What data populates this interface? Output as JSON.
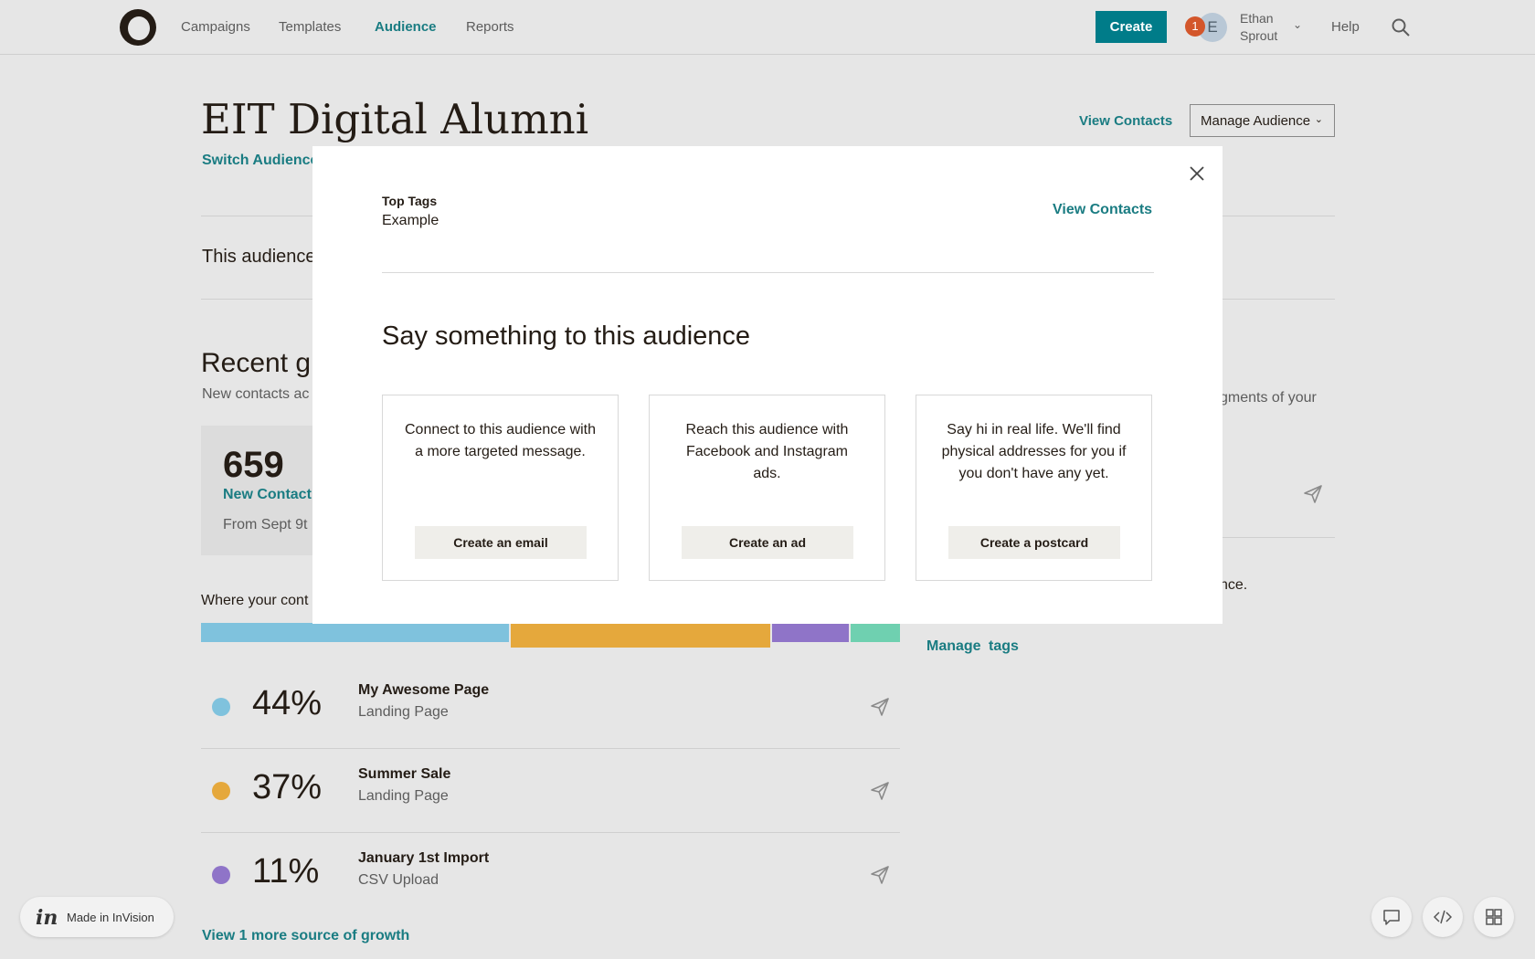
{
  "nav": {
    "links": [
      "Campaigns",
      "Templates",
      "Audience",
      "Reports"
    ],
    "create_label": "Create",
    "notifications": "1",
    "avatar_initial": "E",
    "user_first": "Ethan",
    "user_last": "Sprout",
    "help_label": "Help"
  },
  "page": {
    "title": "EIT Digital Alumni",
    "switch_label": "Switch Audience",
    "view_contacts": "View Contacts",
    "manage_audience": "Manage Audience",
    "audience_text": "This audience",
    "recent_title": "Recent gr",
    "recent_sub": "New contacts ac",
    "stat_number": "659",
    "stat_label": "New Contact",
    "stat_date": "From Sept 9t",
    "where_text": "Where your cont",
    "right_fragment_1": "gments of your",
    "right_fragment_2": "nce.",
    "manage_tags": "Manage  tags",
    "more_growth": "View 1 more source of growth"
  },
  "sources": [
    {
      "pct": "44%",
      "name": "My Awesome Page",
      "type": "Landing Page",
      "color": "#7fc2dd",
      "share": 44
    },
    {
      "pct": "37%",
      "name": "Summer Sale",
      "type": "Landing Page",
      "color": "#e5a83c",
      "share": 37
    },
    {
      "pct": "11%",
      "name": "January 1st Import",
      "type": "CSV Upload",
      "color": "#8f74c8",
      "share": 11
    }
  ],
  "modal": {
    "top_tags_label": "Top Tags",
    "top_tags_value": "Example",
    "view_contacts": "View Contacts",
    "heading": "Say something to this audience",
    "cards": [
      {
        "desc": "Connect to this audience with a more targeted message.",
        "button": "Create an email"
      },
      {
        "desc": "Reach this audience with Facebook and Instagram ads.",
        "button": "Create an ad"
      },
      {
        "desc": "Say hi in real life. We'll find physical addresses for you if you don't have any yet.",
        "button": "Create a postcard"
      }
    ]
  },
  "invision_label": "Made in InVision",
  "colors": {
    "accent": "#007c89",
    "link": "#1a7c82",
    "bar4": "#6fd0b0"
  }
}
